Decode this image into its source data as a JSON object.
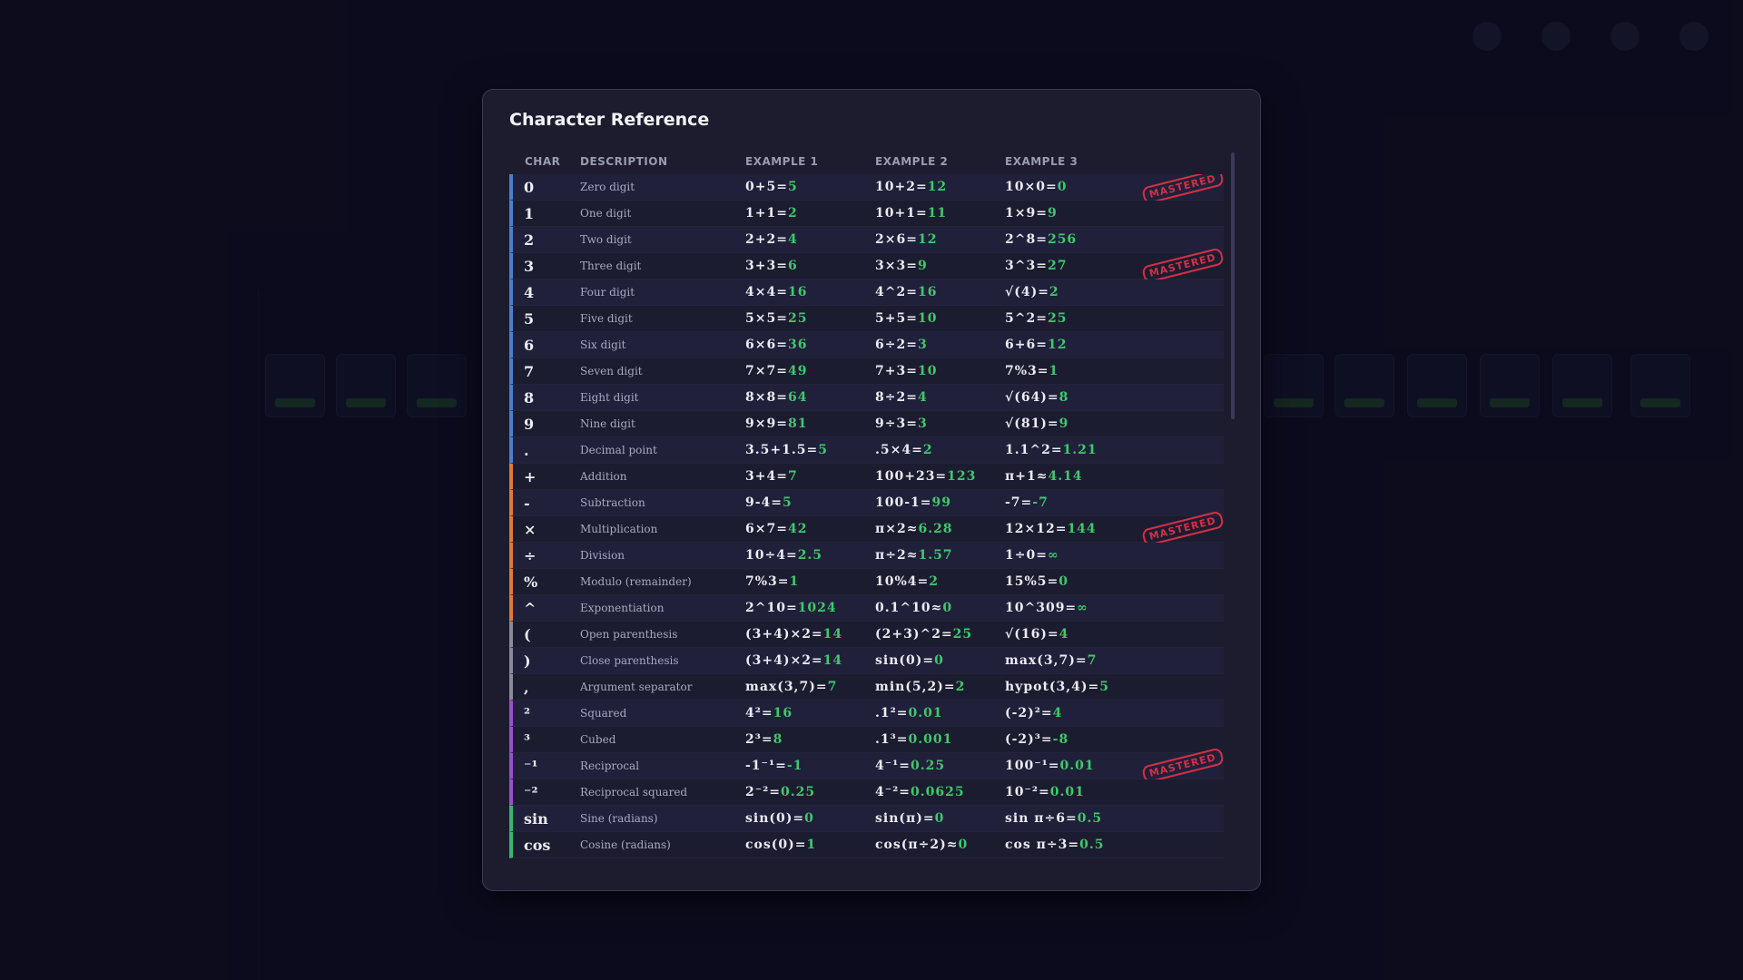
{
  "colors": {
    "digit": "#4a7fd0",
    "operator": "#e07a30",
    "paren": "#8a8a9a",
    "power": "#9a4fd0",
    "function": "#2fb870",
    "result": "#3ec96b",
    "stamp": "#d23045"
  },
  "modal": {
    "title": "Character Reference",
    "columns": {
      "char": "CHAR",
      "description": "DESCRIPTION",
      "example1": "EXAMPLE 1",
      "example2": "EXAMPLE 2",
      "example3": "EXAMPLE 3"
    },
    "stamp_label": "MASTERED",
    "rows": [
      {
        "char": "0",
        "desc": "Zero digit",
        "group": "digit",
        "mastered": true,
        "ex": [
          {
            "e": "0+5=",
            "r": "5"
          },
          {
            "e": "10+2=",
            "r": "12"
          },
          {
            "e": "10×0=",
            "r": "0"
          }
        ]
      },
      {
        "char": "1",
        "desc": "One digit",
        "group": "digit",
        "mastered": false,
        "ex": [
          {
            "e": "1+1=",
            "r": "2"
          },
          {
            "e": "10+1=",
            "r": "11"
          },
          {
            "e": "1×9=",
            "r": "9"
          }
        ]
      },
      {
        "char": "2",
        "desc": "Two digit",
        "group": "digit",
        "mastered": false,
        "ex": [
          {
            "e": "2+2=",
            "r": "4"
          },
          {
            "e": "2×6=",
            "r": "12"
          },
          {
            "e": "2^8=",
            "r": "256"
          }
        ]
      },
      {
        "char": "3",
        "desc": "Three digit",
        "group": "digit",
        "mastered": true,
        "ex": [
          {
            "e": "3+3=",
            "r": "6"
          },
          {
            "e": "3×3=",
            "r": "9"
          },
          {
            "e": "3^3=",
            "r": "27"
          }
        ]
      },
      {
        "char": "4",
        "desc": "Four digit",
        "group": "digit",
        "mastered": false,
        "ex": [
          {
            "e": "4×4=",
            "r": "16"
          },
          {
            "e": "4^2=",
            "r": "16"
          },
          {
            "e": "√(4)=",
            "r": "2"
          }
        ]
      },
      {
        "char": "5",
        "desc": "Five digit",
        "group": "digit",
        "mastered": false,
        "ex": [
          {
            "e": "5×5=",
            "r": "25"
          },
          {
            "e": "5+5=",
            "r": "10"
          },
          {
            "e": "5^2=",
            "r": "25"
          }
        ]
      },
      {
        "char": "6",
        "desc": "Six digit",
        "group": "digit",
        "mastered": false,
        "ex": [
          {
            "e": "6×6=",
            "r": "36"
          },
          {
            "e": "6÷2=",
            "r": "3"
          },
          {
            "e": "6+6=",
            "r": "12"
          }
        ]
      },
      {
        "char": "7",
        "desc": "Seven digit",
        "group": "digit",
        "mastered": false,
        "ex": [
          {
            "e": "7×7=",
            "r": "49"
          },
          {
            "e": "7+3=",
            "r": "10"
          },
          {
            "e": "7%3=",
            "r": "1"
          }
        ]
      },
      {
        "char": "8",
        "desc": "Eight digit",
        "group": "digit",
        "mastered": false,
        "ex": [
          {
            "e": "8×8=",
            "r": "64"
          },
          {
            "e": "8÷2=",
            "r": "4"
          },
          {
            "e": "√(64)=",
            "r": "8"
          }
        ]
      },
      {
        "char": "9",
        "desc": "Nine digit",
        "group": "digit",
        "mastered": false,
        "ex": [
          {
            "e": "9×9=",
            "r": "81"
          },
          {
            "e": "9÷3=",
            "r": "3"
          },
          {
            "e": "√(81)=",
            "r": "9"
          }
        ]
      },
      {
        "char": ".",
        "desc": "Decimal point",
        "group": "digit",
        "mastered": false,
        "ex": [
          {
            "e": "3.5+1.5=",
            "r": "5"
          },
          {
            "e": ".5×4=",
            "r": "2"
          },
          {
            "e": "1.1^2=",
            "r": "1.21"
          }
        ]
      },
      {
        "char": "+",
        "desc": "Addition",
        "group": "operator",
        "mastered": false,
        "ex": [
          {
            "e": "3+4=",
            "r": "7"
          },
          {
            "e": "100+23=",
            "r": "123"
          },
          {
            "e": "π+1≈",
            "r": "4.14"
          }
        ]
      },
      {
        "char": "-",
        "desc": "Subtraction",
        "group": "operator",
        "mastered": false,
        "ex": [
          {
            "e": "9-4=",
            "r": "5"
          },
          {
            "e": "100-1=",
            "r": "99"
          },
          {
            "e": "-7=",
            "r": "-7"
          }
        ]
      },
      {
        "char": "×",
        "desc": "Multiplication",
        "group": "operator",
        "mastered": true,
        "ex": [
          {
            "e": "6×7=",
            "r": "42"
          },
          {
            "e": "π×2≈",
            "r": "6.28"
          },
          {
            "e": "12×12=",
            "r": "144"
          }
        ]
      },
      {
        "char": "÷",
        "desc": "Division",
        "group": "operator",
        "mastered": false,
        "ex": [
          {
            "e": "10÷4=",
            "r": "2.5"
          },
          {
            "e": "π÷2≈",
            "r": "1.57"
          },
          {
            "e": "1÷0=",
            "r": "∞"
          }
        ]
      },
      {
        "char": "%",
        "desc": "Modulo (remainder)",
        "group": "operator",
        "mastered": false,
        "ex": [
          {
            "e": "7%3=",
            "r": "1"
          },
          {
            "e": "10%4=",
            "r": "2"
          },
          {
            "e": "15%5=",
            "r": "0"
          }
        ]
      },
      {
        "char": "^",
        "desc": "Exponentiation",
        "group": "operator",
        "mastered": false,
        "ex": [
          {
            "e": "2^10=",
            "r": "1024"
          },
          {
            "e": "0.1^10≈",
            "r": "0"
          },
          {
            "e": "10^309=",
            "r": "∞"
          }
        ]
      },
      {
        "char": "(",
        "desc": "Open parenthesis",
        "group": "paren",
        "mastered": false,
        "ex": [
          {
            "e": "(3+4)×2=",
            "r": "14"
          },
          {
            "e": "(2+3)^2=",
            "r": "25"
          },
          {
            "e": "√(16)=",
            "r": "4"
          }
        ]
      },
      {
        "char": ")",
        "desc": "Close parenthesis",
        "group": "paren",
        "mastered": false,
        "ex": [
          {
            "e": "(3+4)×2=",
            "r": "14"
          },
          {
            "e": "sin(0)=",
            "r": "0"
          },
          {
            "e": "max(3,7)=",
            "r": "7"
          }
        ]
      },
      {
        "char": ",",
        "desc": "Argument separator",
        "group": "paren",
        "mastered": false,
        "ex": [
          {
            "e": "max(3,7)=",
            "r": "7"
          },
          {
            "e": "min(5,2)=",
            "r": "2"
          },
          {
            "e": "hypot(3,4)=",
            "r": "5"
          }
        ]
      },
      {
        "char": "²",
        "desc": "Squared",
        "group": "power",
        "mastered": false,
        "ex": [
          {
            "e": "4²=",
            "r": "16"
          },
          {
            "e": ".1²=",
            "r": "0.01"
          },
          {
            "e": "(-2)²=",
            "r": "4"
          }
        ]
      },
      {
        "char": "³",
        "desc": "Cubed",
        "group": "power",
        "mastered": false,
        "ex": [
          {
            "e": "2³=",
            "r": "8"
          },
          {
            "e": ".1³=",
            "r": "0.001"
          },
          {
            "e": "(-2)³=",
            "r": "-8"
          }
        ]
      },
      {
        "char": "⁻¹",
        "desc": "Reciprocal",
        "group": "power",
        "mastered": true,
        "ex": [
          {
            "e": "-1⁻¹=",
            "r": "-1"
          },
          {
            "e": "4⁻¹=",
            "r": "0.25"
          },
          {
            "e": "100⁻¹=",
            "r": "0.01"
          }
        ]
      },
      {
        "char": "⁻²",
        "desc": "Reciprocal squared",
        "group": "power",
        "mastered": false,
        "ex": [
          {
            "e": "2⁻²=",
            "r": "0.25"
          },
          {
            "e": "4⁻²=",
            "r": "0.0625"
          },
          {
            "e": "10⁻²=",
            "r": "0.01"
          }
        ]
      },
      {
        "char": "sin",
        "desc": "Sine (radians)",
        "group": "function",
        "mastered": false,
        "ex": [
          {
            "e": "sin(0)=",
            "r": "0"
          },
          {
            "e": "sin(π)=",
            "r": "0"
          },
          {
            "e": "sin π÷6=",
            "r": "0.5"
          }
        ]
      },
      {
        "char": "cos",
        "desc": "Cosine (radians)",
        "group": "function",
        "mastered": false,
        "ex": [
          {
            "e": "cos(0)=",
            "r": "1"
          },
          {
            "e": "cos(π÷2)≈",
            "r": "0"
          },
          {
            "e": "cos π÷3=",
            "r": "0.5"
          }
        ]
      }
    ]
  }
}
